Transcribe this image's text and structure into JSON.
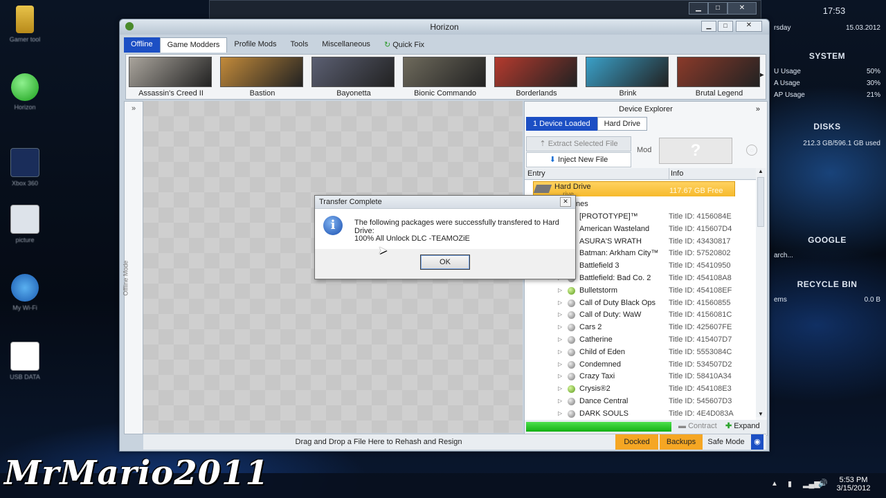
{
  "desktop": {
    "icons": [
      {
        "label": "Gamer tool",
        "icon": "folder-icon"
      },
      {
        "label": "Horizon",
        "icon": "play-icon"
      },
      {
        "label": "Xbox 360",
        "icon": "app-icon"
      },
      {
        "label": "picture",
        "icon": "image-icon"
      },
      {
        "label": "My Wi-Fi",
        "icon": "network-icon"
      },
      {
        "label": "USB DATA",
        "icon": "word-document-icon"
      }
    ]
  },
  "gadgets": {
    "clock": "17:53",
    "day": "rsday",
    "date": "15.03.2012",
    "system_title": "SYSTEM",
    "system_rows": [
      {
        "label": "U Usage",
        "value": "50%"
      },
      {
        "label": "A Usage",
        "value": "30%"
      },
      {
        "label": "AP Usage",
        "value": "21%"
      }
    ],
    "disks_title": "DISKS",
    "disks_value": "212.3 GB/596.1 GB used",
    "google_title": "GOOGLE",
    "google_search": "arch...",
    "recycle_title": "RECYCLE BIN",
    "recycle_items": "ems",
    "recycle_size": "0.0 B"
  },
  "window": {
    "title": "Horizon",
    "menu": [
      {
        "label": "Offline",
        "style": "blue"
      },
      {
        "label": "Game Modders",
        "style": "active"
      },
      {
        "label": "Profile Mods",
        "style": ""
      },
      {
        "label": "Tools",
        "style": ""
      },
      {
        "label": "Miscellaneous",
        "style": ""
      },
      {
        "label": "Quick Fix",
        "style": ""
      }
    ],
    "games": [
      {
        "name": "Assassin's Creed II",
        "color": "#a9a49c"
      },
      {
        "name": "Bastion",
        "color": "#c28a3a"
      },
      {
        "name": "Bayonetta",
        "color": "#5b5f72"
      },
      {
        "name": "Bionic Commando",
        "color": "#6e6a5c"
      },
      {
        "name": "Borderlands",
        "color": "#b43a2e"
      },
      {
        "name": "Brink",
        "color": "#3aa0c8"
      },
      {
        "name": "Brutal Legend",
        "color": "#8a3a2a"
      }
    ],
    "left_strip": {
      "expand": "»",
      "label": "Offline Mode"
    },
    "device_explorer": {
      "title": "Device Explorer",
      "collapse": "»",
      "tab_devices": "1 Device Loaded",
      "tab_drive": "Hard Drive",
      "extract": "Extract Selected File",
      "inject": "Inject New File",
      "mod_label": "Mod",
      "mod_placeholder": "?",
      "col_entry": "Entry",
      "col_info": "Info",
      "root": {
        "name": "Hard Drive",
        "sub": "rive",
        "info": "117.67 GB Free"
      },
      "group_label": "nes",
      "items": [
        {
          "name": "[PROTOTYPE]™",
          "info": "Title ID: 4156084E",
          "green": false
        },
        {
          "name": "American Wasteland",
          "info": "Title ID: 415607D4",
          "green": false
        },
        {
          "name": "ASURA'S WRATH",
          "info": "Title ID: 43430817",
          "green": false
        },
        {
          "name": "Batman: Arkham City™",
          "info": "Title ID: 57520802",
          "green": false
        },
        {
          "name": "Battlefield 3",
          "info": "Title ID: 45410950",
          "green": false
        },
        {
          "name": "Battlefield: Bad Co. 2",
          "info": "Title ID: 454108A8",
          "green": false
        },
        {
          "name": "Bulletstorm",
          "info": "Title ID: 454108EF",
          "green": true
        },
        {
          "name": "Call of Duty Black Ops",
          "info": "Title ID: 41560855",
          "green": false
        },
        {
          "name": "Call of Duty: WaW",
          "info": "Title ID: 4156081C",
          "green": false
        },
        {
          "name": "Cars 2",
          "info": "Title ID: 425607FE",
          "green": false
        },
        {
          "name": "Catherine",
          "info": "Title ID: 415407D7",
          "green": false
        },
        {
          "name": "Child of Eden",
          "info": "Title ID: 5553084C",
          "green": false
        },
        {
          "name": "Condemned",
          "info": "Title ID: 534507D2",
          "green": false
        },
        {
          "name": "Crazy Taxi",
          "info": "Title ID: 58410A34",
          "green": false
        },
        {
          "name": "Crysis®2",
          "info": "Title ID: 454108E3",
          "green": true
        },
        {
          "name": "Dance Central",
          "info": "Title ID: 545607D3",
          "green": false
        },
        {
          "name": "DARK SOULS",
          "info": "Title ID: 4E4D083A",
          "green": false
        }
      ],
      "progress": 1.0,
      "contract": "Contract",
      "expand": "Expand"
    },
    "status": {
      "drop_text": "Drag and Drop a File Here to Rehash and Resign",
      "docked": "Docked",
      "backups": "Backups",
      "safe_mode": "Safe Mode"
    }
  },
  "dialog": {
    "title": "Transfer Complete",
    "message": "The following packages were successfully transfered to Hard Drive:",
    "package": "100% All Unlock DLC -TEAMOZiE",
    "ok": "OK",
    "icon": "info-icon"
  },
  "taskbar": {
    "time": "5:53 PM",
    "date": "3/15/2012"
  },
  "watermark": "MrMario2011"
}
